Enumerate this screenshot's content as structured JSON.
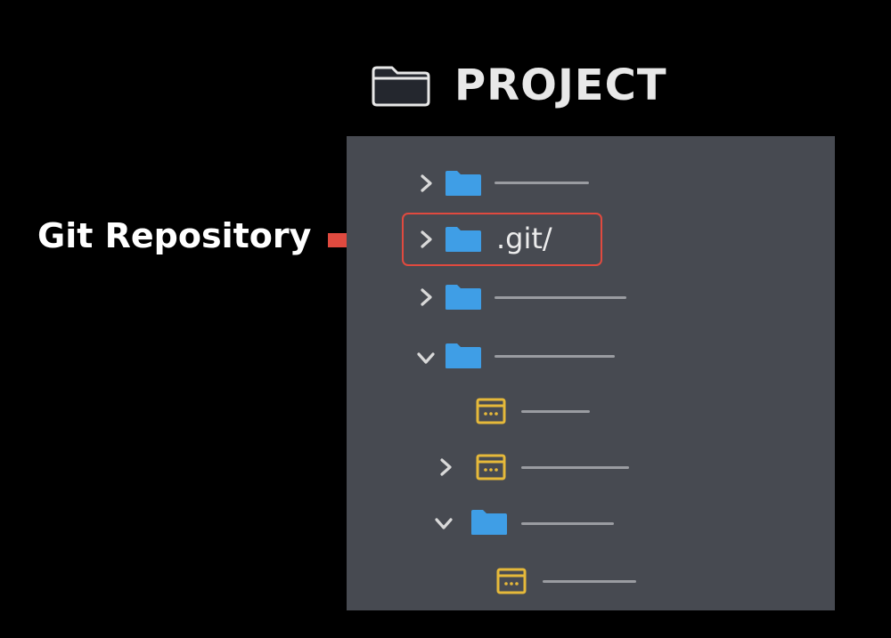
{
  "header": {
    "title": "PROJECT",
    "icon": "folder-icon"
  },
  "callout": {
    "label": "Git Repository",
    "arrow_color": "#e04a3f"
  },
  "tree": {
    "highlighted_folder": ".git/",
    "items": [
      {
        "kind": "folder",
        "expanded": false,
        "named": false
      },
      {
        "kind": "folder",
        "expanded": false,
        "named": true,
        "label": ".git/"
      },
      {
        "kind": "folder",
        "expanded": false,
        "named": false
      },
      {
        "kind": "folder",
        "expanded": true,
        "named": false
      },
      {
        "kind": "file",
        "has_children": false,
        "named": false
      },
      {
        "kind": "file",
        "has_children": true,
        "expanded": false,
        "named": false
      },
      {
        "kind": "folder",
        "expanded": true,
        "named": false
      },
      {
        "kind": "file",
        "has_children": false,
        "named": false
      }
    ]
  },
  "colors": {
    "background": "#000000",
    "panel": "#474a51",
    "folder": "#3f9ee6",
    "file": "#e6b93a",
    "chevron": "#d9d9d9",
    "highlight": "#e04a3f"
  }
}
